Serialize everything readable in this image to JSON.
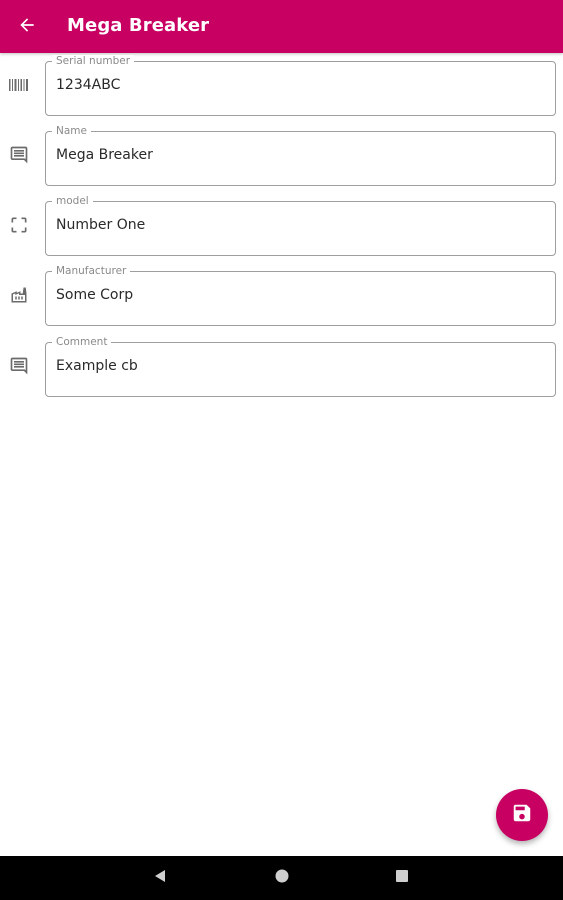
{
  "appbar": {
    "title": "Mega Breaker",
    "back_icon": "arrow-left-icon",
    "background_color": "#c70061"
  },
  "fields": [
    {
      "icon": "barcode-icon",
      "label": "Serial number",
      "value": "1234ABC"
    },
    {
      "icon": "comment-icon",
      "label": "Name",
      "value": "Mega Breaker"
    },
    {
      "icon": "focus-frame-icon",
      "label": "model",
      "value": "Number One"
    },
    {
      "icon": "factory-icon",
      "label": "Manufacturer",
      "value": "Some Corp"
    },
    {
      "icon": "comment-icon",
      "label": "Comment",
      "value": "Example cb"
    }
  ],
  "fab": {
    "icon": "save-icon",
    "color": "#c70061"
  },
  "navbar": {
    "back": "triangle-back-icon",
    "home": "circle-home-icon",
    "recents": "square-recents-icon"
  }
}
